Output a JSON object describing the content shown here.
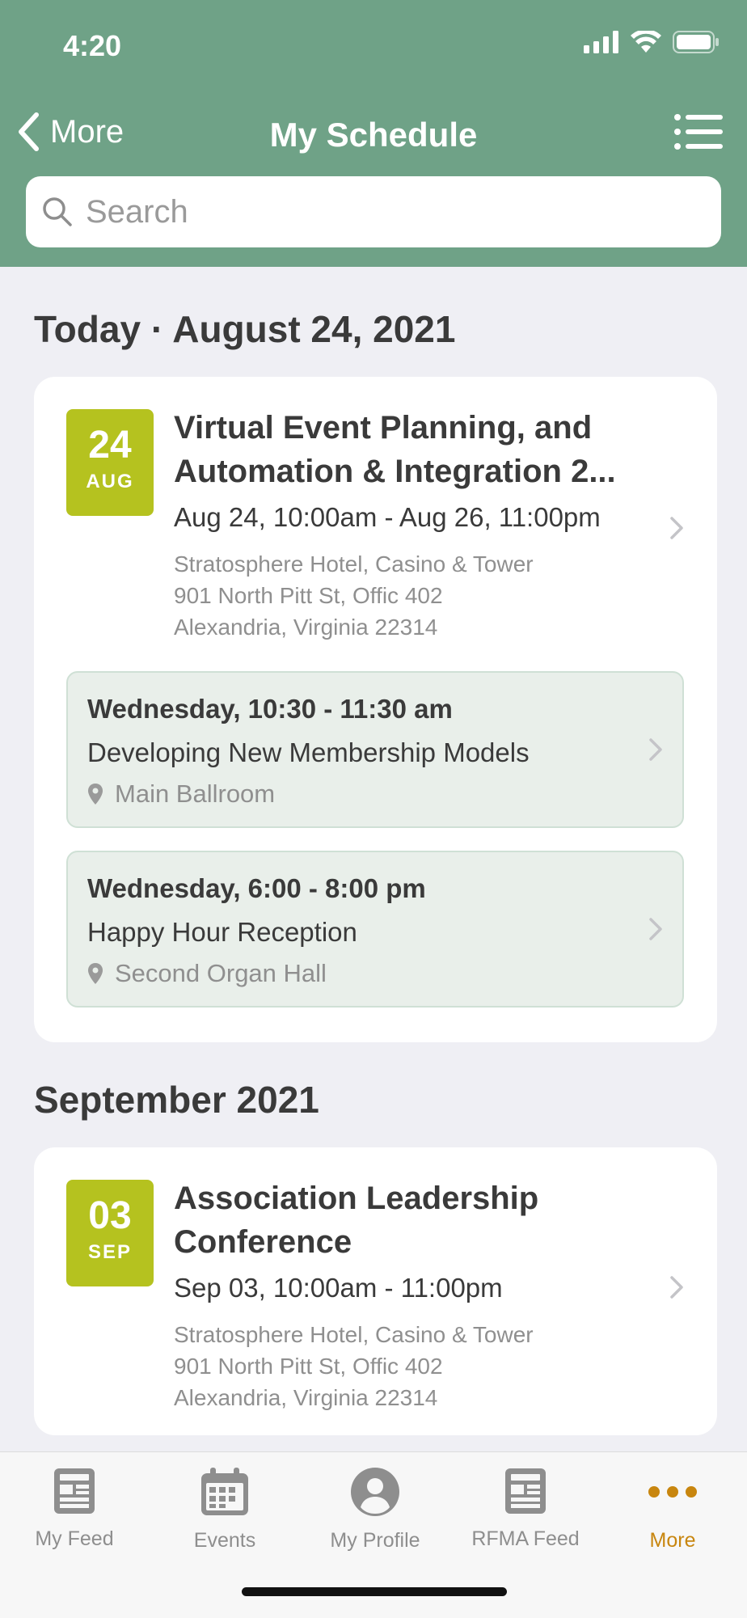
{
  "status_bar": {
    "time": "4:20"
  },
  "nav": {
    "back_label": "More",
    "title": "My Schedule"
  },
  "search": {
    "placeholder": "Search"
  },
  "sections": [
    {
      "title": "Today · August 24, 2021",
      "event": {
        "badge_day": "24",
        "badge_month": "AUG",
        "title_line1": "Virtual Event Planning, and",
        "title_line2": "Automation & Integration 2...",
        "time": "Aug 24, 10:00am - Aug 26, 11:00pm",
        "address": [
          "Stratosphere Hotel, Casino & Tower",
          "901 North Pitt St, Offic 402",
          "Alexandria, Virginia 22314"
        ],
        "sessions": [
          {
            "time": "Wednesday, 10:30 - 11:30 am",
            "name": "Developing New Membership Models",
            "location": "Main Ballroom"
          },
          {
            "time": "Wednesday, 6:00 - 8:00 pm",
            "name": "Happy Hour Reception",
            "location": "Second Organ Hall"
          }
        ]
      }
    },
    {
      "title": "September 2021",
      "event": {
        "badge_day": "03",
        "badge_month": "SEP",
        "title_line1": "Association Leadership",
        "title_line2": "Conference",
        "time": "Sep 03, 10:00am - 11:00pm",
        "address": [
          "Stratosphere Hotel, Casino & Tower",
          "901 North Pitt St, Offic 402",
          "Alexandria, Virginia 22314"
        ]
      }
    }
  ],
  "tabbar": {
    "items": [
      {
        "label": "My Feed",
        "icon": "feed-icon"
      },
      {
        "label": "Events",
        "icon": "calendar-icon"
      },
      {
        "label": "My Profile",
        "icon": "profile-icon"
      },
      {
        "label": "RFMA Feed",
        "icon": "feed-icon"
      },
      {
        "label": "More",
        "icon": "more-icon",
        "active": true
      }
    ]
  },
  "colors": {
    "header": "#6fa287",
    "badge": "#b5c21f",
    "active_tab": "#c8860f"
  }
}
